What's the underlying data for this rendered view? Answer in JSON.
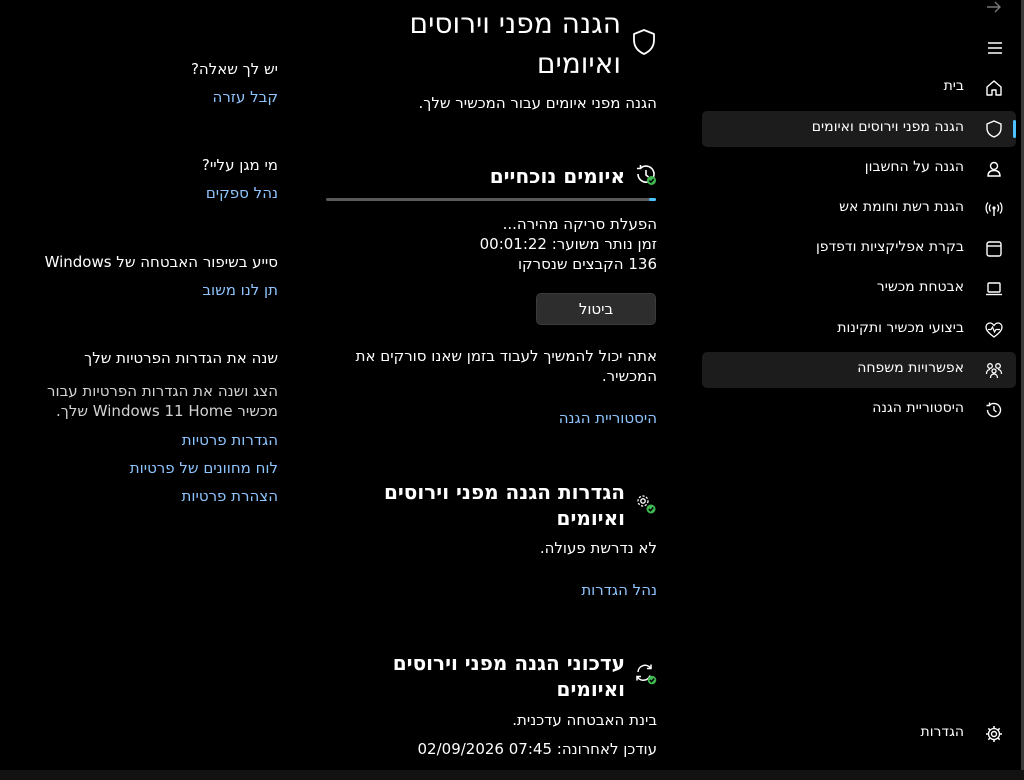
{
  "nav": {
    "items": [
      {
        "label": "בית",
        "icon": "home-icon"
      },
      {
        "label": "הגנה מפני וירוסים ואיומים",
        "icon": "shield-icon",
        "selected": true
      },
      {
        "label": "הגנה על החשבון",
        "icon": "account-icon"
      },
      {
        "label": "הגנת רשת וחומת אש",
        "icon": "network-icon"
      },
      {
        "label": "בקרת אפליקציות ודפדפן",
        "icon": "browser-icon"
      },
      {
        "label": "אבטחת מכשיר",
        "icon": "laptop-icon"
      },
      {
        "label": "ביצועי מכשיר ותקינות",
        "icon": "heart-pulse-icon"
      },
      {
        "label": "אפשרויות משפחה",
        "icon": "family-icon"
      },
      {
        "label": "היסטוריית הגנה",
        "icon": "history-icon"
      }
    ],
    "settings_label": "הגדרות"
  },
  "main": {
    "title_line1": "הגנה מפני וירוסים",
    "title_line2": "ואיומים",
    "subtitle": "הגנה מפני איומים עבור המכשיר שלך.",
    "current_threats": {
      "heading": "איומים נוכחיים",
      "scan_status": "הפעלת סריקה מהירה...",
      "time_remaining": "זמן נותר משוער: 00:01:22",
      "files_scanned": "136 הקבצים שנסרקו",
      "cancel_label": "ביטול",
      "note_line1": "אתה יכול להמשיך לעבוד בזמן שאנו סורקים את",
      "note_line2": "המכשיר.",
      "history_link": "היסטוריית הגנה",
      "progress_fraction": 0.02
    },
    "settings_section": {
      "heading_line1": "הגדרות הגנה מפני וירוסים",
      "heading_line2": "ואיומים",
      "status": "לא נדרשת פעולה.",
      "link": "נהל הגדרות"
    },
    "updates_section": {
      "heading_line1": "עדכוני הגנה מפני וירוסים",
      "heading_line2": "ואיומים",
      "status": "בינת האבטחה עדכנית.",
      "last_updated": "עודכן לאחרונה: 07:45 02/09/2026"
    }
  },
  "side": {
    "question": {
      "heading": "יש לך שאלה?",
      "link": "קבל עזרה"
    },
    "protector": {
      "heading": "מי מגן עליי?",
      "link": "נהל ספקים"
    },
    "feedback": {
      "heading": "סייע בשיפור האבטחה של Windows",
      "link": "תן לנו משוב"
    },
    "privacy": {
      "heading": "שנה את הגדרות הפרטיות שלך",
      "desc_line1": "הצג ושנה את הגדרות הפרטיות עבור",
      "desc_line2": "מכשיר Windows 11 Home שלך.",
      "links": [
        "הגדרות פרטיות",
        "לוח מחוונים של פרטיות",
        "הצהרת פרטיות"
      ]
    }
  },
  "colors": {
    "accent": "#4cc2ff",
    "link": "#8ec5ff",
    "background": "#000000",
    "ok_green": "#3fb950"
  }
}
